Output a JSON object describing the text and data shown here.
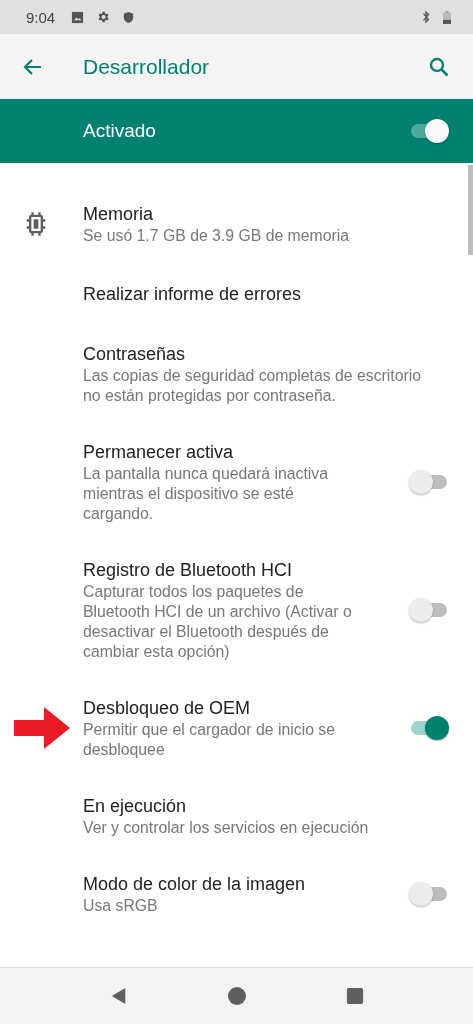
{
  "status_bar": {
    "time": "9:04"
  },
  "toolbar": {
    "title": "Desarrollador"
  },
  "master_switch": {
    "label": "Activado",
    "on": true
  },
  "items": [
    {
      "kind": "icon_entry",
      "title": "Memoria",
      "summary": "Se usó 1.7 GB de 3.9 GB de memoria",
      "arrow": false
    },
    {
      "kind": "entry",
      "title": "Realizar informe de errores",
      "arrow": false
    },
    {
      "kind": "entry",
      "title": "Contraseñas",
      "summary": "Las copias de seguridad completas de escritorio no están protegidas por contraseña.",
      "arrow": false
    },
    {
      "kind": "toggle",
      "title": "Permanecer activa",
      "summary": "La pantalla nunca quedará inactiva mientras el dispositivo se esté cargando.",
      "on": false,
      "arrow": false
    },
    {
      "kind": "toggle",
      "title": "Registro de Bluetooth HCI",
      "summary": "Capturar todos los paquetes de Bluetooth HCI de un archivo (Activar o desactivar el Bluetooth después de cambiar esta opción)",
      "on": false,
      "arrow": false
    },
    {
      "kind": "toggle",
      "title": "Desbloqueo de OEM",
      "summary": "Permitir que el cargador de inicio se desbloquee",
      "on": true,
      "arrow": true
    },
    {
      "kind": "entry",
      "title": "En ejecución",
      "summary": "Ver y controlar los servicios en ejecución",
      "arrow": false
    },
    {
      "kind": "toggle",
      "title": "Modo de color de la imagen",
      "summary": "Usa sRGB",
      "on": false,
      "arrow": false
    }
  ]
}
